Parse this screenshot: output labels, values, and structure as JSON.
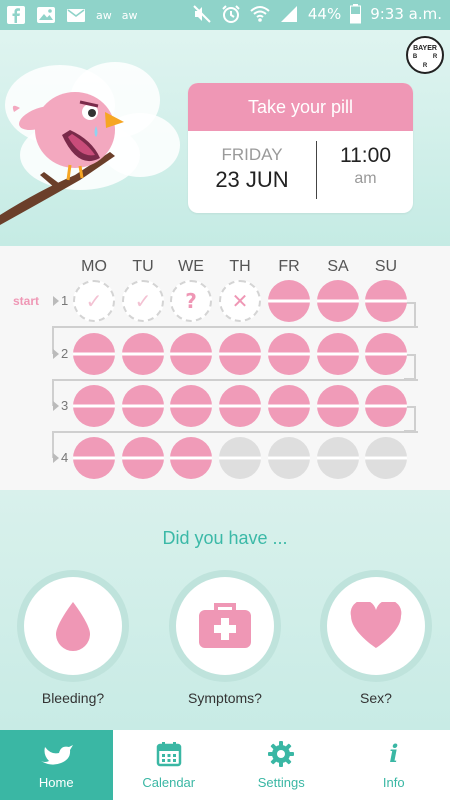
{
  "status_bar": {
    "battery": "44%",
    "time": "9:33 a.m.",
    "notif_label_1": "aw",
    "notif_label_2": "aw"
  },
  "header": {
    "brand": "BAYER",
    "card_title": "Take your pill",
    "day": "FRIDAY",
    "date": "23 JUN",
    "time": "11:00",
    "ampm": "am"
  },
  "pill_pack": {
    "start_label": "start",
    "days": [
      "MO",
      "TU",
      "WE",
      "TH",
      "FR",
      "SA",
      "SU"
    ],
    "weeks": [
      {
        "number": "1",
        "pills": [
          "taken",
          "taken",
          "unknown",
          "missed",
          "active",
          "active",
          "active"
        ]
      },
      {
        "number": "2",
        "pills": [
          "active",
          "active",
          "active",
          "active",
          "active",
          "active",
          "active"
        ]
      },
      {
        "number": "3",
        "pills": [
          "active",
          "active",
          "active",
          "active",
          "active",
          "active",
          "active"
        ]
      },
      {
        "number": "4",
        "pills": [
          "active",
          "active",
          "active",
          "placebo",
          "placebo",
          "placebo",
          "placebo"
        ]
      }
    ]
  },
  "tracker": {
    "question": "Did you have ...",
    "items": [
      {
        "label": "Bleeding?",
        "icon": "drop-icon"
      },
      {
        "label": "Symptoms?",
        "icon": "first-aid-kit-icon"
      },
      {
        "label": "Sex?",
        "icon": "heart-icon"
      }
    ]
  },
  "nav": {
    "items": [
      {
        "label": "Home",
        "icon": "bird-icon",
        "active": true
      },
      {
        "label": "Calendar",
        "icon": "calendar-icon",
        "active": false
      },
      {
        "label": "Settings",
        "icon": "gear-icon",
        "active": false
      },
      {
        "label": "Info",
        "icon": "info-icon",
        "active": false
      }
    ]
  },
  "colors": {
    "teal": "#3ab7a4",
    "pink": "#ef97b5",
    "placebo_gray": "#dedede"
  }
}
